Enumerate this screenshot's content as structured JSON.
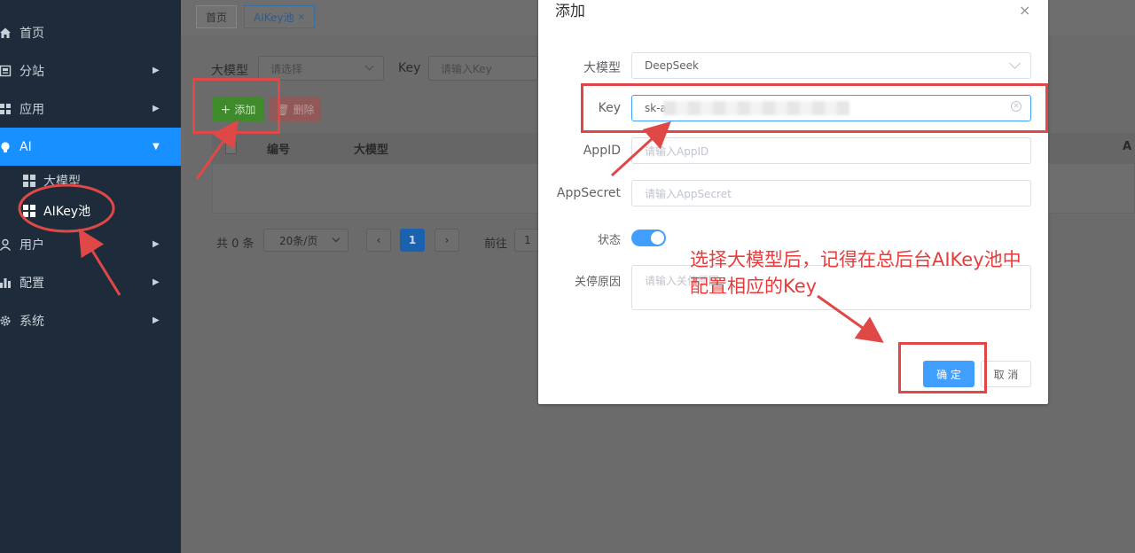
{
  "sidebar": {
    "items": [
      {
        "label": "首页",
        "icon": "home-icon",
        "has_arrow": false
      },
      {
        "label": "分站",
        "icon": "substation-icon",
        "has_arrow": true
      },
      {
        "label": "应用",
        "icon": "grid-icon",
        "has_arrow": true
      },
      {
        "label": "AI",
        "icon": "bulb-icon",
        "has_arrow": true,
        "active": true
      },
      {
        "label": "用户",
        "icon": "user-icon",
        "has_arrow": true
      },
      {
        "label": "配置",
        "icon": "bar-chart-icon",
        "has_arrow": true
      },
      {
        "label": "系统",
        "icon": "gear-icon",
        "has_arrow": true
      }
    ],
    "sub_items": [
      {
        "label": "大模型"
      },
      {
        "label": "AIKey池",
        "current": true
      }
    ],
    "active_color": "#1890ff"
  },
  "tabs": [
    {
      "label": "首页"
    },
    {
      "label": "AIKey池",
      "close": "×",
      "active": true
    }
  ],
  "filters": {
    "model_label": "大模型",
    "model_placeholder": "请选择",
    "key_label": "Key",
    "key_placeholder": "请输入Key"
  },
  "toolbar": {
    "add_label": "添加",
    "add_icon": "+",
    "delete_label": "删除"
  },
  "table": {
    "headers": [
      "编号",
      "大模型",
      "A"
    ]
  },
  "pagination": {
    "total": "共 0 条",
    "page_size": "20条/页",
    "current_page": "1",
    "goto_label": "前往",
    "goto_value": "1"
  },
  "dialog": {
    "title": "添加",
    "close": "×",
    "fields": {
      "model_label": "大模型",
      "model_value": "DeepSeek",
      "key_label": "Key",
      "key_value": "sk-a",
      "appid_label": "AppID",
      "appid_placeholder": "请输入AppID",
      "appsecret_label": "AppSecret",
      "appsecret_placeholder": "请输入AppSecret",
      "status_label": "状态",
      "status_on": true,
      "reason_label": "关停原因",
      "reason_placeholder": "请输入关停原因"
    },
    "confirm_label": "确 定",
    "cancel_label": "取 消",
    "primary_color": "#409eff"
  },
  "annotation": {
    "line1": "选择大模型后，记得在总后台AIKey池中",
    "line2": "配置相应的Key",
    "color": "#e83c3c"
  }
}
